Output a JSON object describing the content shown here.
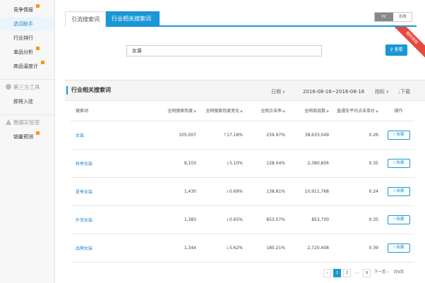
{
  "sidebar": {
    "items": [
      {
        "label": "竞争情报",
        "flag": true
      },
      {
        "label": "选词助手",
        "flag": false,
        "active": true
      },
      {
        "label": "行业排行",
        "flag": false
      },
      {
        "label": "单品分析",
        "flag": true
      },
      {
        "label": "商品温度计",
        "flag": true
      }
    ],
    "section1": {
      "label": "第三方工具"
    },
    "section1_items": [
      {
        "label": "即将入驻"
      }
    ],
    "section2": {
      "label": "数据实验室"
    },
    "section2_items": [
      {
        "label": "销量预测",
        "flag": true
      }
    ]
  },
  "tabs": [
    {
      "label": "引流搜索词"
    },
    {
      "label": "行业相关搜索词"
    }
  ],
  "device_switch": {
    "pc": "PC",
    "wireless": "无线"
  },
  "ribbon": {
    "label": "限时体验"
  },
  "search": {
    "value": "女装",
    "button": "查看"
  },
  "panel": {
    "title": "行业相关搜索词",
    "date_label": "日期",
    "date_range": "2016-08-16~2016-08-16",
    "metric_label": "指标",
    "download_label": "下载"
  },
  "table": {
    "headers": [
      "搜索词",
      "全网搜索热度",
      "全网搜索热度变化",
      "全网点击率",
      "全网商品数",
      "直通车平均点击单价",
      "操作"
    ],
    "rows": [
      {
        "kw": "女装",
        "heat": "105,007",
        "dir": "up",
        "change": "17.18%",
        "ctr": "259.97%",
        "items": "38,633,049",
        "cpc": "0.26",
        "op": "收藏"
      },
      {
        "kw": "秋季女装",
        "heat": "8,103",
        "dir": "down",
        "change": "5.10%",
        "ctr": "128.04%",
        "items": "2,380,856",
        "cpc": "0.35",
        "op": "收藏"
      },
      {
        "kw": "夏季女装",
        "heat": "1,430",
        "dir": "down",
        "change": "0.69%",
        "ctr": "138.81%",
        "items": "10,911,768",
        "cpc": "0.24",
        "op": "收藏"
      },
      {
        "kw": "外贸女装",
        "heat": "1,383",
        "dir": "down",
        "change": "0.65%",
        "ctr": "853.07%",
        "items": "853,700",
        "cpc": "0.35",
        "op": "收藏"
      },
      {
        "kw": "品牌女装",
        "heat": "1,344",
        "dir": "down",
        "change": "5.62%",
        "ctr": "180.21%",
        "items": "2,720,408",
        "cpc": "0.39",
        "op": "收藏"
      }
    ]
  },
  "pagination": {
    "prev": "‹",
    "pages": [
      "1",
      "2",
      "...",
      "9"
    ],
    "next": "下一页 ›",
    "total": "共9页"
  },
  "colors": {
    "accent": "#1a97d5",
    "up": "#e8483c",
    "down": "#2ba44b",
    "flag": "#f39c12"
  }
}
